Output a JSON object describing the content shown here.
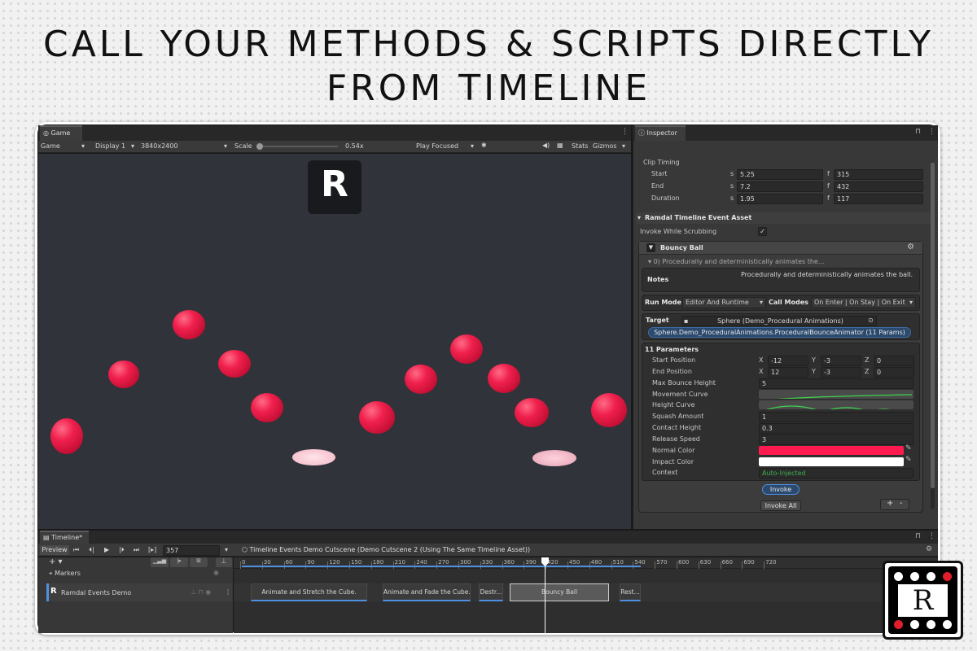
{
  "headline": {
    "line1": "CALL YOUR METHODS & SCRIPTS DIRECTLY",
    "line2": "FROM TIMELINE"
  },
  "game": {
    "tab": "Game",
    "mode": "Game",
    "display": "Display 1",
    "resolution": "3840x2400",
    "scale_label": "Scale",
    "scale_value": "0.54x",
    "play_focused": "Play Focused",
    "stats": "Stats",
    "gizmos": "Gizmos",
    "logo_letter": "R"
  },
  "inspector": {
    "tab": "Inspector",
    "clip_timing": "Clip Timing",
    "rows": [
      {
        "label": "Start",
        "s": "5.25",
        "f": "315"
      },
      {
        "label": "End",
        "s": "7.2",
        "f": "432"
      },
      {
        "label": "Duration",
        "s": "1.95",
        "f": "117"
      }
    ],
    "s_unit": "s",
    "f_unit": "f",
    "asset_title": "Ramdal Timeline Event Asset",
    "invoke_scrubbing": "Invoke While Scrubbing",
    "event_name": "Bouncy Ball",
    "event_summary": "0) Procedurally and deterministically animates the...",
    "notes_label": "Notes",
    "notes_text": "Procedurally and deterministically animates the ball.",
    "run_mode_label": "Run Mode",
    "run_mode_value": "Editor And Runtime",
    "call_modes_label": "Call Modes",
    "call_modes_value": "On Enter | On Stay | On Exit",
    "target_label": "Target",
    "target_value": "Sphere (Demo_Procedural Animations)",
    "method_value": "Sphere.Demo_ProceduralAnimations.ProceduralBounceAnimator (11 Params)",
    "params_title": "11 Parameters",
    "start_position": {
      "label": "Start Position",
      "x": "-12",
      "y": "-3",
      "z": "0"
    },
    "end_position": {
      "label": "End Position",
      "x": "12",
      "y": "-3",
      "z": "0"
    },
    "x_label": "X",
    "y_label": "Y",
    "z_label": "Z",
    "max_bounce_height": {
      "label": "Max Bounce Height",
      "value": "5"
    },
    "movement_curve": "Movement Curve",
    "height_curve": "Height Curve",
    "squash_amount": {
      "label": "Squash Amount",
      "value": "1"
    },
    "contact_height": {
      "label": "Contact Height",
      "value": "0.3"
    },
    "release_speed": {
      "label": "Release Speed",
      "value": "3"
    },
    "normal_color": {
      "label": "Normal Color",
      "color": "#ff1a4f"
    },
    "impact_color": {
      "label": "Impact Color",
      "color": "#ffffff"
    },
    "context": {
      "label": "Context",
      "value": "Auto-Injected"
    },
    "invoke_button": "Invoke",
    "invoke_all_button": "Invoke All",
    "plus": "+",
    "minus": "-"
  },
  "timeline": {
    "tab": "Timeline*",
    "preview": "Preview",
    "frame": "357",
    "title": "Timeline Events Demo Cutscene (Demo Cutscene 2 (Using The Same Timeline Asset))",
    "markers": "Markers",
    "track": "Ramdal Events Demo",
    "ruler": [
      "0",
      "30",
      "60",
      "90",
      "120",
      "150",
      "180",
      "210",
      "240",
      "270",
      "300",
      "330",
      "360",
      "390",
      "420",
      "450",
      "480",
      "510",
      "540",
      "570",
      "600",
      "630",
      "660",
      "690",
      "720"
    ],
    "clips": [
      {
        "label": "Animate and Stretch the Cube."
      },
      {
        "label": "Animate and Fade the Cube."
      },
      {
        "label": "Destr..."
      },
      {
        "label": "Bouncy Ball"
      },
      {
        "label": "Rest..."
      }
    ]
  },
  "corner_logo": {
    "letter": "R"
  },
  "colors": {
    "accent_blue": "#4f8fe0",
    "ball_red": "#f0204d",
    "context_green": "#3fb04f"
  }
}
